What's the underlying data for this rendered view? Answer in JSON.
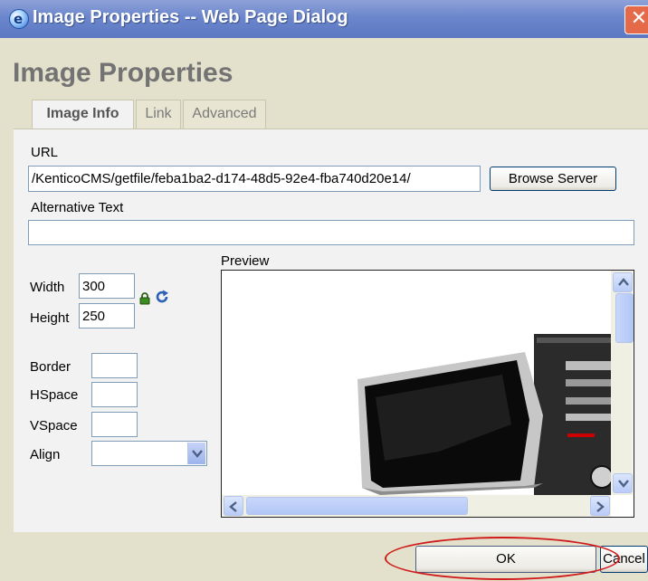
{
  "titlebar": {
    "title": "Image Properties -- Web Page Dialog",
    "icon": "ie-icon",
    "close_glyph": "✕"
  },
  "dialog": {
    "heading": "Image Properties"
  },
  "tabs": [
    {
      "label": "Image Info",
      "active": true
    },
    {
      "label": "Link",
      "active": false
    },
    {
      "label": "Advanced",
      "active": false
    }
  ],
  "form": {
    "url_label": "URL",
    "url_value": "/KenticoCMS/getfile/feba1ba2-d174-48d5-92e4-fba740d20e14/",
    "browse_button": "Browse Server",
    "alt_label": "Alternative Text",
    "alt_value": "",
    "width_label": "Width",
    "width_value": "300",
    "height_label": "Height",
    "height_value": "250",
    "border_label": "Border",
    "border_value": "",
    "hspace_label": "HSpace",
    "hspace_value": "",
    "vspace_label": "VSpace",
    "vspace_value": "",
    "align_label": "Align",
    "align_value": ""
  },
  "preview": {
    "label": "Preview",
    "image": "desktop-computer-monitor"
  },
  "footer": {
    "ok_button": "OK",
    "cancel_button": "Cancel"
  },
  "colors": {
    "dialog_bg": "#e3e1cc",
    "titlebar": "#6b86cc",
    "highlight_ellipse": "#d01a1a"
  }
}
